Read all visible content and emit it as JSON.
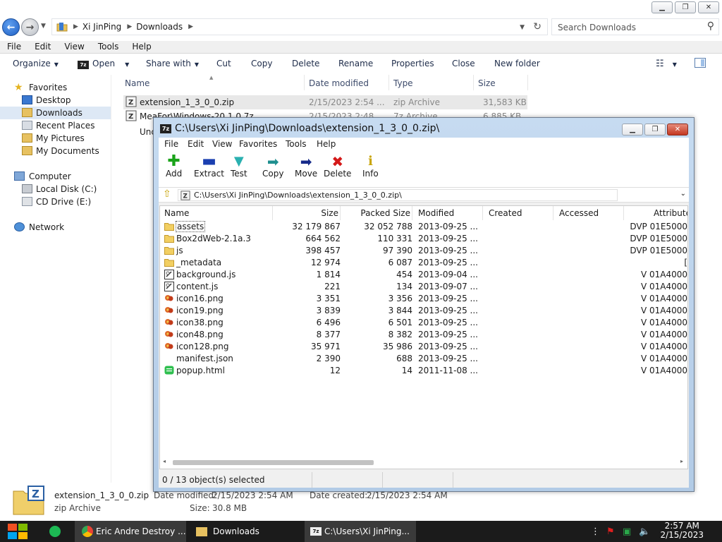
{
  "explorer": {
    "breadcrumb": [
      "Xi JinPing",
      "Downloads"
    ],
    "search_placeholder": "Search Downloads",
    "menu": [
      "File",
      "Edit",
      "View",
      "Tools",
      "Help"
    ],
    "commands": {
      "organize": "Organize",
      "open": "Open",
      "share": "Share with",
      "cut": "Cut",
      "copy": "Copy",
      "delete": "Delete",
      "rename": "Rename",
      "properties": "Properties",
      "close": "Close",
      "new_folder": "New folder"
    },
    "nav": {
      "favorites": "Favorites",
      "desktop": "Desktop",
      "downloads": "Downloads",
      "recent": "Recent Places",
      "pictures": "My Pictures",
      "documents": "My Documents",
      "computer": "Computer",
      "local_disk": "Local Disk (C:)",
      "cd_drive": "CD Drive (E:)",
      "network": "Network"
    },
    "columns": {
      "name": "Name",
      "date": "Date modified",
      "type": "Type",
      "size": "Size"
    },
    "files": [
      {
        "name": "extension_1_3_0_0.zip",
        "date": "2/15/2023 2:54 ...",
        "type": "zip Archive",
        "size": "31,583 KB"
      },
      {
        "name": "MeaFor\\Windows-20.1.0.7z",
        "date": "2/15/2023 2:48 ...",
        "type": "7z Archive",
        "size": "6,885 KB"
      },
      {
        "name": "Unc",
        "date": "",
        "type": "",
        "size": ""
      }
    ],
    "details": {
      "filename": "extension_1_3_0_0.zip",
      "filetype": "zip Archive",
      "modified_label": "Date modified:",
      "modified_value": "2/15/2023 2:54 AM",
      "created_label": "Date created:",
      "created_value": "2/15/2023 2:54 AM",
      "size_label": "Size:",
      "size_value": "30.8 MB"
    }
  },
  "sevenzip": {
    "title": "C:\\Users\\Xi JinPing\\Downloads\\extension_1_3_0_0.zip\\",
    "menu": [
      "File",
      "Edit",
      "View",
      "Favorites",
      "Tools",
      "Help"
    ],
    "toolbar": [
      "Add",
      "Extract",
      "Test",
      "Copy",
      "Move",
      "Delete",
      "Info"
    ],
    "path": "C:\\Users\\Xi JinPing\\Downloads\\extension_1_3_0_0.zip\\",
    "columns": [
      "Name",
      "Size",
      "Packed Size",
      "Modified",
      "Created",
      "Accessed",
      "Attribute"
    ],
    "rows": [
      {
        "name": "assets",
        "size": "32 179 867",
        "packed": "32 052 788",
        "modified": "2013-09-25 ...",
        "attr": "DVP 01E5000",
        "kind": "folder"
      },
      {
        "name": "Box2dWeb-2.1a.3",
        "size": "664 562",
        "packed": "110 331",
        "modified": "2013-09-25 ...",
        "attr": "DVP 01E5000",
        "kind": "folder"
      },
      {
        "name": "js",
        "size": "398 457",
        "packed": "97 390",
        "modified": "2013-09-25 ...",
        "attr": "DVP 01E5000",
        "kind": "folder"
      },
      {
        "name": "_metadata",
        "size": "12 974",
        "packed": "6 087",
        "modified": "2013-09-25 ...",
        "attr": "[",
        "kind": "folder"
      },
      {
        "name": "background.js",
        "size": "1 814",
        "packed": "454",
        "modified": "2013-09-04 ...",
        "attr": "V 01A4000",
        "kind": "script"
      },
      {
        "name": "content.js",
        "size": "221",
        "packed": "134",
        "modified": "2013-09-07 ...",
        "attr": "V 01A4000",
        "kind": "script"
      },
      {
        "name": "icon16.png",
        "size": "3 351",
        "packed": "3 356",
        "modified": "2013-09-25 ...",
        "attr": "V 01A4000",
        "kind": "image"
      },
      {
        "name": "icon19.png",
        "size": "3 839",
        "packed": "3 844",
        "modified": "2013-09-25 ...",
        "attr": "V 01A4000",
        "kind": "image"
      },
      {
        "name": "icon38.png",
        "size": "6 496",
        "packed": "6 501",
        "modified": "2013-09-25 ...",
        "attr": "V 01A4000",
        "kind": "image"
      },
      {
        "name": "icon48.png",
        "size": "8 377",
        "packed": "8 382",
        "modified": "2013-09-25 ...",
        "attr": "V 01A4000",
        "kind": "image"
      },
      {
        "name": "icon128.png",
        "size": "35 971",
        "packed": "35 986",
        "modified": "2013-09-25 ...",
        "attr": "V 01A4000",
        "kind": "image"
      },
      {
        "name": "manifest.json",
        "size": "2 390",
        "packed": "688",
        "modified": "2013-09-25 ...",
        "attr": "V 01A4000",
        "kind": "file"
      },
      {
        "name": "popup.html",
        "size": "12",
        "packed": "14",
        "modified": "2011-11-08 ...",
        "attr": "V 01A4000",
        "kind": "html"
      }
    ],
    "status": "0 / 13 object(s) selected"
  },
  "taskbar": {
    "items": [
      "Eric Andre Destroy ...",
      "Downloads",
      "C:\\Users\\Xi JinPing..."
    ],
    "time": "2:57 AM",
    "date": "2/15/2023"
  },
  "colors": {
    "selection": "#dde8f5",
    "accent": "#1f5fc4",
    "taskbar": "#1b1b1b",
    "sevenzip_frame": "#b9d1ea"
  }
}
